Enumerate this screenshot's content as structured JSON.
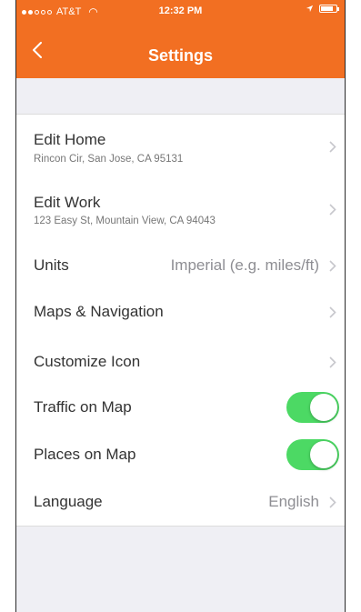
{
  "status": {
    "carrier": "AT&T",
    "time": "12:32 PM",
    "battery_percent": 80
  },
  "nav": {
    "title": "Settings"
  },
  "settings": [
    {
      "label": "Edit Home",
      "sub": "Rincon Cir, San Jose, CA 95131"
    },
    {
      "label": "Edit Work",
      "sub": "123 Easy St, Mountain View, CA 94043"
    },
    {
      "label": "Units",
      "value": "Imperial (e.g. miles/ft)"
    },
    {
      "label": "Maps & Navigation"
    },
    {
      "label": "Customize Icon"
    },
    {
      "label": "Traffic on Map",
      "toggle": "on"
    },
    {
      "label": "Places on Map",
      "toggle": "on"
    },
    {
      "label": "Language",
      "value": "English"
    }
  ],
  "colors": {
    "accent": "#f26f22",
    "toggle_on": "#4cd964",
    "background": "#efeff4"
  }
}
